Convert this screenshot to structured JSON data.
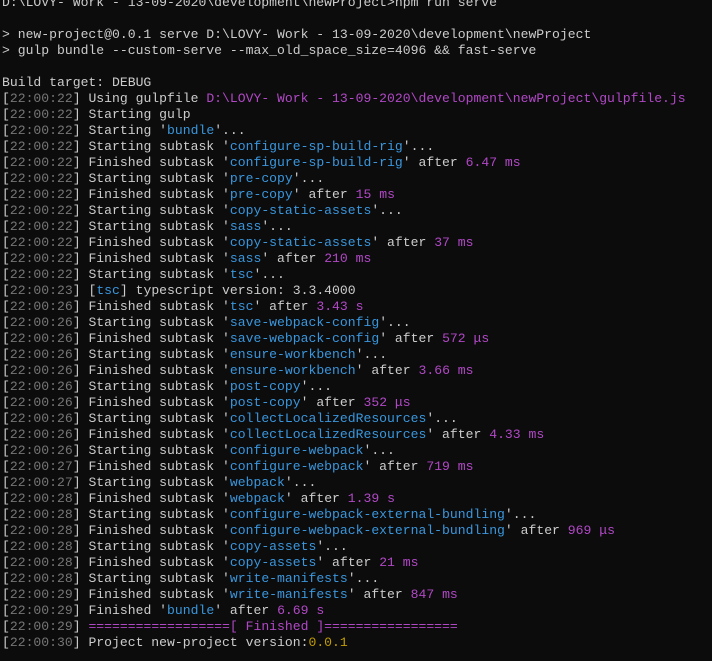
{
  "terminal": {
    "lines": [
      {
        "segs": [
          {
            "text": "D:\\LOVY- Work - 13-09-2020\\development\\newProject>npm run serve",
            "c": ""
          }
        ]
      },
      {
        "segs": []
      },
      {
        "segs": [
          {
            "text": "> new-project@0.0.1 serve D:\\LOVY- Work - 13-09-2020\\development\\newProject",
            "c": ""
          }
        ]
      },
      {
        "segs": [
          {
            "text": "> gulp bundle --custom-serve --max_old_space_size=4096 && fast-serve",
            "c": ""
          }
        ]
      },
      {
        "segs": []
      },
      {
        "segs": [
          {
            "text": "Build target: DEBUG",
            "c": ""
          }
        ]
      },
      {
        "segs": [
          {
            "text": "[",
            "c": ""
          },
          {
            "text": "22:00:22",
            "c": "ts"
          },
          {
            "text": "] Using gulpfile ",
            "c": ""
          },
          {
            "text": "D:\\LOVY- Work - 13-09-2020\\development\\newProject\\gulpfile.js",
            "c": "magenta"
          }
        ]
      },
      {
        "segs": [
          {
            "text": "[",
            "c": ""
          },
          {
            "text": "22:00:22",
            "c": "ts"
          },
          {
            "text": "] Starting gulp",
            "c": ""
          }
        ]
      },
      {
        "segs": [
          {
            "text": "[",
            "c": ""
          },
          {
            "text": "22:00:22",
            "c": "ts"
          },
          {
            "text": "] Starting '",
            "c": ""
          },
          {
            "text": "bundle",
            "c": "blue"
          },
          {
            "text": "'...",
            "c": ""
          }
        ]
      },
      {
        "segs": [
          {
            "text": "[",
            "c": ""
          },
          {
            "text": "22:00:22",
            "c": "ts"
          },
          {
            "text": "] Starting subtask '",
            "c": ""
          },
          {
            "text": "configure-sp-build-rig",
            "c": "blue"
          },
          {
            "text": "'...",
            "c": ""
          }
        ]
      },
      {
        "segs": [
          {
            "text": "[",
            "c": ""
          },
          {
            "text": "22:00:22",
            "c": "ts"
          },
          {
            "text": "] Finished subtask '",
            "c": ""
          },
          {
            "text": "configure-sp-build-rig",
            "c": "blue"
          },
          {
            "text": "' after ",
            "c": ""
          },
          {
            "text": "6.47 ms",
            "c": "magenta"
          }
        ]
      },
      {
        "segs": [
          {
            "text": "[",
            "c": ""
          },
          {
            "text": "22:00:22",
            "c": "ts"
          },
          {
            "text": "] Starting subtask '",
            "c": ""
          },
          {
            "text": "pre-copy",
            "c": "blue"
          },
          {
            "text": "'...",
            "c": ""
          }
        ]
      },
      {
        "segs": [
          {
            "text": "[",
            "c": ""
          },
          {
            "text": "22:00:22",
            "c": "ts"
          },
          {
            "text": "] Finished subtask '",
            "c": ""
          },
          {
            "text": "pre-copy",
            "c": "blue"
          },
          {
            "text": "' after ",
            "c": ""
          },
          {
            "text": "15 ms",
            "c": "magenta"
          }
        ]
      },
      {
        "segs": [
          {
            "text": "[",
            "c": ""
          },
          {
            "text": "22:00:22",
            "c": "ts"
          },
          {
            "text": "] Starting subtask '",
            "c": ""
          },
          {
            "text": "copy-static-assets",
            "c": "blue"
          },
          {
            "text": "'...",
            "c": ""
          }
        ]
      },
      {
        "segs": [
          {
            "text": "[",
            "c": ""
          },
          {
            "text": "22:00:22",
            "c": "ts"
          },
          {
            "text": "] Starting subtask '",
            "c": ""
          },
          {
            "text": "sass",
            "c": "blue"
          },
          {
            "text": "'...",
            "c": ""
          }
        ]
      },
      {
        "segs": [
          {
            "text": "[",
            "c": ""
          },
          {
            "text": "22:00:22",
            "c": "ts"
          },
          {
            "text": "] Finished subtask '",
            "c": ""
          },
          {
            "text": "copy-static-assets",
            "c": "blue"
          },
          {
            "text": "' after ",
            "c": ""
          },
          {
            "text": "37 ms",
            "c": "magenta"
          }
        ]
      },
      {
        "segs": [
          {
            "text": "[",
            "c": ""
          },
          {
            "text": "22:00:22",
            "c": "ts"
          },
          {
            "text": "] Finished subtask '",
            "c": ""
          },
          {
            "text": "sass",
            "c": "blue"
          },
          {
            "text": "' after ",
            "c": ""
          },
          {
            "text": "210 ms",
            "c": "magenta"
          }
        ]
      },
      {
        "segs": [
          {
            "text": "[",
            "c": ""
          },
          {
            "text": "22:00:22",
            "c": "ts"
          },
          {
            "text": "] Starting subtask '",
            "c": ""
          },
          {
            "text": "tsc",
            "c": "blue"
          },
          {
            "text": "'...",
            "c": ""
          }
        ]
      },
      {
        "segs": [
          {
            "text": "[",
            "c": ""
          },
          {
            "text": "22:00:23",
            "c": "ts"
          },
          {
            "text": "] [",
            "c": ""
          },
          {
            "text": "tsc",
            "c": "blue"
          },
          {
            "text": "] typescript version: 3.3.4000",
            "c": ""
          }
        ]
      },
      {
        "segs": [
          {
            "text": "[",
            "c": ""
          },
          {
            "text": "22:00:26",
            "c": "ts"
          },
          {
            "text": "] Finished subtask '",
            "c": ""
          },
          {
            "text": "tsc",
            "c": "blue"
          },
          {
            "text": "' after ",
            "c": ""
          },
          {
            "text": "3.43 s",
            "c": "magenta"
          }
        ]
      },
      {
        "segs": [
          {
            "text": "[",
            "c": ""
          },
          {
            "text": "22:00:26",
            "c": "ts"
          },
          {
            "text": "] Starting subtask '",
            "c": ""
          },
          {
            "text": "save-webpack-config",
            "c": "blue"
          },
          {
            "text": "'...",
            "c": ""
          }
        ]
      },
      {
        "segs": [
          {
            "text": "[",
            "c": ""
          },
          {
            "text": "22:00:26",
            "c": "ts"
          },
          {
            "text": "] Finished subtask '",
            "c": ""
          },
          {
            "text": "save-webpack-config",
            "c": "blue"
          },
          {
            "text": "' after ",
            "c": ""
          },
          {
            "text": "572 μs",
            "c": "magenta"
          }
        ]
      },
      {
        "segs": [
          {
            "text": "[",
            "c": ""
          },
          {
            "text": "22:00:26",
            "c": "ts"
          },
          {
            "text": "] Starting subtask '",
            "c": ""
          },
          {
            "text": "ensure-workbench",
            "c": "blue"
          },
          {
            "text": "'...",
            "c": ""
          }
        ]
      },
      {
        "segs": [
          {
            "text": "[",
            "c": ""
          },
          {
            "text": "22:00:26",
            "c": "ts"
          },
          {
            "text": "] Finished subtask '",
            "c": ""
          },
          {
            "text": "ensure-workbench",
            "c": "blue"
          },
          {
            "text": "' after ",
            "c": ""
          },
          {
            "text": "3.66 ms",
            "c": "magenta"
          }
        ]
      },
      {
        "segs": [
          {
            "text": "[",
            "c": ""
          },
          {
            "text": "22:00:26",
            "c": "ts"
          },
          {
            "text": "] Starting subtask '",
            "c": ""
          },
          {
            "text": "post-copy",
            "c": "blue"
          },
          {
            "text": "'...",
            "c": ""
          }
        ]
      },
      {
        "segs": [
          {
            "text": "[",
            "c": ""
          },
          {
            "text": "22:00:26",
            "c": "ts"
          },
          {
            "text": "] Finished subtask '",
            "c": ""
          },
          {
            "text": "post-copy",
            "c": "blue"
          },
          {
            "text": "' after ",
            "c": ""
          },
          {
            "text": "352 μs",
            "c": "magenta"
          }
        ]
      },
      {
        "segs": [
          {
            "text": "[",
            "c": ""
          },
          {
            "text": "22:00:26",
            "c": "ts"
          },
          {
            "text": "] Starting subtask '",
            "c": ""
          },
          {
            "text": "collectLocalizedResources",
            "c": "blue"
          },
          {
            "text": "'...",
            "c": ""
          }
        ]
      },
      {
        "segs": [
          {
            "text": "[",
            "c": ""
          },
          {
            "text": "22:00:26",
            "c": "ts"
          },
          {
            "text": "] Finished subtask '",
            "c": ""
          },
          {
            "text": "collectLocalizedResources",
            "c": "blue"
          },
          {
            "text": "' after ",
            "c": ""
          },
          {
            "text": "4.33 ms",
            "c": "magenta"
          }
        ]
      },
      {
        "segs": [
          {
            "text": "[",
            "c": ""
          },
          {
            "text": "22:00:26",
            "c": "ts"
          },
          {
            "text": "] Starting subtask '",
            "c": ""
          },
          {
            "text": "configure-webpack",
            "c": "blue"
          },
          {
            "text": "'...",
            "c": ""
          }
        ]
      },
      {
        "segs": [
          {
            "text": "[",
            "c": ""
          },
          {
            "text": "22:00:27",
            "c": "ts"
          },
          {
            "text": "] Finished subtask '",
            "c": ""
          },
          {
            "text": "configure-webpack",
            "c": "blue"
          },
          {
            "text": "' after ",
            "c": ""
          },
          {
            "text": "719 ms",
            "c": "magenta"
          }
        ]
      },
      {
        "segs": [
          {
            "text": "[",
            "c": ""
          },
          {
            "text": "22:00:27",
            "c": "ts"
          },
          {
            "text": "] Starting subtask '",
            "c": ""
          },
          {
            "text": "webpack",
            "c": "blue"
          },
          {
            "text": "'...",
            "c": ""
          }
        ]
      },
      {
        "segs": [
          {
            "text": "[",
            "c": ""
          },
          {
            "text": "22:00:28",
            "c": "ts"
          },
          {
            "text": "] Finished subtask '",
            "c": ""
          },
          {
            "text": "webpack",
            "c": "blue"
          },
          {
            "text": "' after ",
            "c": ""
          },
          {
            "text": "1.39 s",
            "c": "magenta"
          }
        ]
      },
      {
        "segs": [
          {
            "text": "[",
            "c": ""
          },
          {
            "text": "22:00:28",
            "c": "ts"
          },
          {
            "text": "] Starting subtask '",
            "c": ""
          },
          {
            "text": "configure-webpack-external-bundling",
            "c": "blue"
          },
          {
            "text": "'...",
            "c": ""
          }
        ]
      },
      {
        "segs": [
          {
            "text": "[",
            "c": ""
          },
          {
            "text": "22:00:28",
            "c": "ts"
          },
          {
            "text": "] Finished subtask '",
            "c": ""
          },
          {
            "text": "configure-webpack-external-bundling",
            "c": "blue"
          },
          {
            "text": "' after ",
            "c": ""
          },
          {
            "text": "969 μs",
            "c": "magenta"
          }
        ]
      },
      {
        "segs": [
          {
            "text": "[",
            "c": ""
          },
          {
            "text": "22:00:28",
            "c": "ts"
          },
          {
            "text": "] Starting subtask '",
            "c": ""
          },
          {
            "text": "copy-assets",
            "c": "blue"
          },
          {
            "text": "'...",
            "c": ""
          }
        ]
      },
      {
        "segs": [
          {
            "text": "[",
            "c": ""
          },
          {
            "text": "22:00:28",
            "c": "ts"
          },
          {
            "text": "] Finished subtask '",
            "c": ""
          },
          {
            "text": "copy-assets",
            "c": "blue"
          },
          {
            "text": "' after ",
            "c": ""
          },
          {
            "text": "21 ms",
            "c": "magenta"
          }
        ]
      },
      {
        "segs": [
          {
            "text": "[",
            "c": ""
          },
          {
            "text": "22:00:28",
            "c": "ts"
          },
          {
            "text": "] Starting subtask '",
            "c": ""
          },
          {
            "text": "write-manifests",
            "c": "blue"
          },
          {
            "text": "'...",
            "c": ""
          }
        ]
      },
      {
        "segs": [
          {
            "text": "[",
            "c": ""
          },
          {
            "text": "22:00:29",
            "c": "ts"
          },
          {
            "text": "] Finished subtask '",
            "c": ""
          },
          {
            "text": "write-manifests",
            "c": "blue"
          },
          {
            "text": "' after ",
            "c": ""
          },
          {
            "text": "847 ms",
            "c": "magenta"
          }
        ]
      },
      {
        "segs": [
          {
            "text": "[",
            "c": ""
          },
          {
            "text": "22:00:29",
            "c": "ts"
          },
          {
            "text": "] Finished '",
            "c": ""
          },
          {
            "text": "bundle",
            "c": "blue"
          },
          {
            "text": "' after ",
            "c": ""
          },
          {
            "text": "6.69 s",
            "c": "magenta"
          }
        ]
      },
      {
        "segs": [
          {
            "text": "[",
            "c": ""
          },
          {
            "text": "22:00:29",
            "c": "ts"
          },
          {
            "text": "] ",
            "c": ""
          },
          {
            "text": "==================[ Finished ]=================",
            "c": "magenta"
          }
        ]
      },
      {
        "segs": [
          {
            "text": "[",
            "c": ""
          },
          {
            "text": "22:00:30",
            "c": "ts"
          },
          {
            "text": "] Project new-project version:",
            "c": ""
          },
          {
            "text": "0.0.1",
            "c": "yellow"
          }
        ]
      }
    ]
  }
}
